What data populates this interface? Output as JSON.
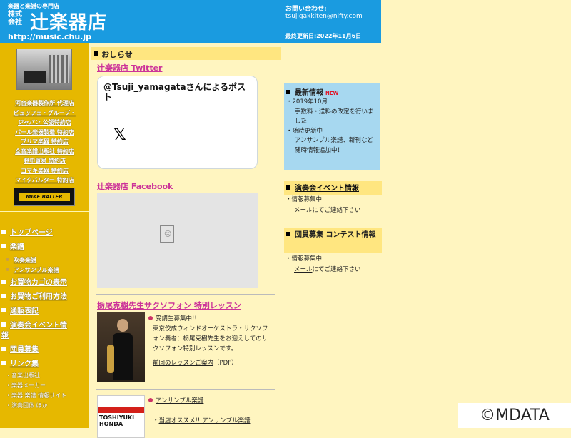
{
  "header": {
    "subtitle": "楽器と楽譜の専門店",
    "kk_line1": "株式",
    "kk_line2": "会社",
    "shop_name": "辻楽器店",
    "url": "http://music.chu.jp",
    "contact_label": "お問い合わせ:",
    "email": "tsujigakkiten@nifty.com",
    "last_updated": "最終更新日:2022年11月6日"
  },
  "sidebar": {
    "dealers": [
      "河合楽器製作所 代理店",
      "ビュッフェ・グループ・",
      "ジャパン 公認特約店",
      "パール楽器製造 特約店",
      "プリマ楽器 特約店",
      "全音楽譜出版社 特約店",
      "野中貿易 特約店",
      "コマキ楽器 特約店",
      "マイクバルター 特約店"
    ],
    "logo_text": "MIKE BALTER",
    "nav": {
      "top": "トップページ",
      "gakufu": "楽譜",
      "sub_suisou": "吹奏楽譜",
      "sub_ensemble": "アンサンブル楽譜",
      "cart": "お買物カゴの表示",
      "guide": "お買物ご利用方法",
      "tsuhan": "通販表記",
      "event_line1": "演奏会イベント情",
      "event_line2": "報",
      "member": "団員募集",
      "links": "リンク集",
      "link_items": [
        "音楽出版社",
        "楽器メーカー",
        "楽器 楽譜 情報サイト",
        "演奏団体 ほか"
      ]
    }
  },
  "center": {
    "notice_title": "おしらせ",
    "twitter_link": "辻楽器店 Twitter",
    "twitter_handle": "@Tsuji_yamagataさんによるポスト",
    "twitter_logo": "𝕏",
    "facebook_link": "辻楽器店 Facebook",
    "lesson_link": "栃尾克樹先生サクソフォン 特別レッスン",
    "lesson_status": "受講生募集中!!",
    "lesson_desc": "東京佼成ウィンドオーケストラ・サクソフォン奏者：栃尾克樹先生をお迎えしてのサクソフォン特別レッスンです。",
    "lesson_guide_link": "前回のレッスンご案内",
    "lesson_guide_suffix": "（PDF）",
    "ensemble_link": "アンサンブル楽譜",
    "ensemble_item": "当店オススメ!! アンサンブル楽譜",
    "ensemble_photo_line1": "TOSHIYUKI",
    "ensemble_photo_line2": "HONDA"
  },
  "right": {
    "news_title": "最新情報",
    "news_badge": "NEW",
    "news_date": "・2019年10月",
    "news_item1": "手数料・送料の改定を行いました",
    "news_sub": "・随時更新中",
    "news_link": "アンサンブル楽譜",
    "news_item2": "、新刊など随時情報追加中！",
    "event_title": "演奏会イベント情報",
    "event_status": "・情報募集中",
    "event_mail_link": "メール",
    "event_mail_text": "にてご連絡下さい",
    "member_title": "団員募集 コンテスト情報",
    "member_status": "・情報募集中",
    "member_mail_link": "メール",
    "member_mail_text": "にてご連絡下さい"
  },
  "watermark": "©MDATA",
  "colors": {
    "header_blue": "#1a9be0",
    "sidebar_gold": "#e6b800",
    "page_cream": "#fff5c0",
    "link_pink": "#cc3399",
    "news_blue": "#a7d8f0"
  }
}
